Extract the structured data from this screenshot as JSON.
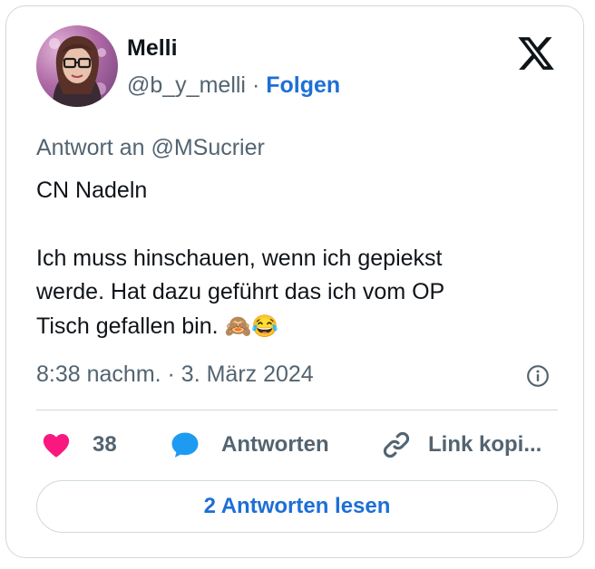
{
  "author": {
    "name": "Melli",
    "handle": "@b_y_melli",
    "separator": "·",
    "follow_label": "Folgen",
    "avatar_icon": "avatar"
  },
  "brand": {
    "logo_icon": "x-logo-icon"
  },
  "tweet": {
    "reply_to": "Antwort an @MSucrier",
    "lines": [
      "CN Nadeln",
      "Ich muss hinschauen, wenn ich gepiekst",
      "werde. Hat dazu geführt das ich vom OP",
      "Tisch gefallen bin."
    ],
    "emojis": [
      "🙈",
      "😂"
    ],
    "timestamp": "8:38 nachm. · 3. März 2024"
  },
  "actions": {
    "like_count": "38",
    "reply_label": "Antworten",
    "copy_link_label": "Link kopi..."
  },
  "read_replies_label": "2 Antworten lesen",
  "colors": {
    "like": "#f91880",
    "reply": "#1d9bf0",
    "link": "#1d6fd6",
    "muted": "#536471",
    "border": "#cfd9de"
  }
}
